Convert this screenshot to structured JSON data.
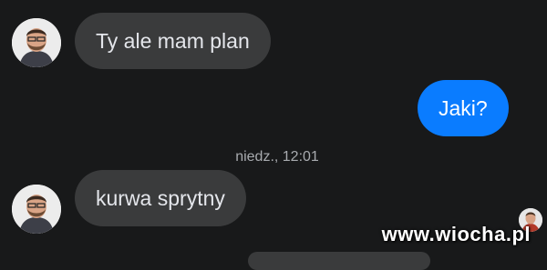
{
  "conversation": {
    "messages": [
      {
        "direction": "received",
        "text": "Ty ale mam plan"
      },
      {
        "direction": "sent",
        "text": "Jaki?"
      },
      {
        "direction": "received",
        "text": "kurwa sprytny"
      }
    ],
    "timestamp": "niedz., 12:01"
  },
  "watermark": {
    "text": "www.wiocha.pl",
    "icon": "wiocha-logo-icon"
  },
  "icons": {
    "contact_avatar": "user-avatar-icon",
    "seen_indicator": "seen-avatar-icon"
  },
  "colors": {
    "background": "#18191a",
    "received_bubble": "#3a3b3c",
    "sent_bubble": "#0a7cff",
    "received_text": "#e4e6eb",
    "timestamp_text": "#a8abaf"
  }
}
